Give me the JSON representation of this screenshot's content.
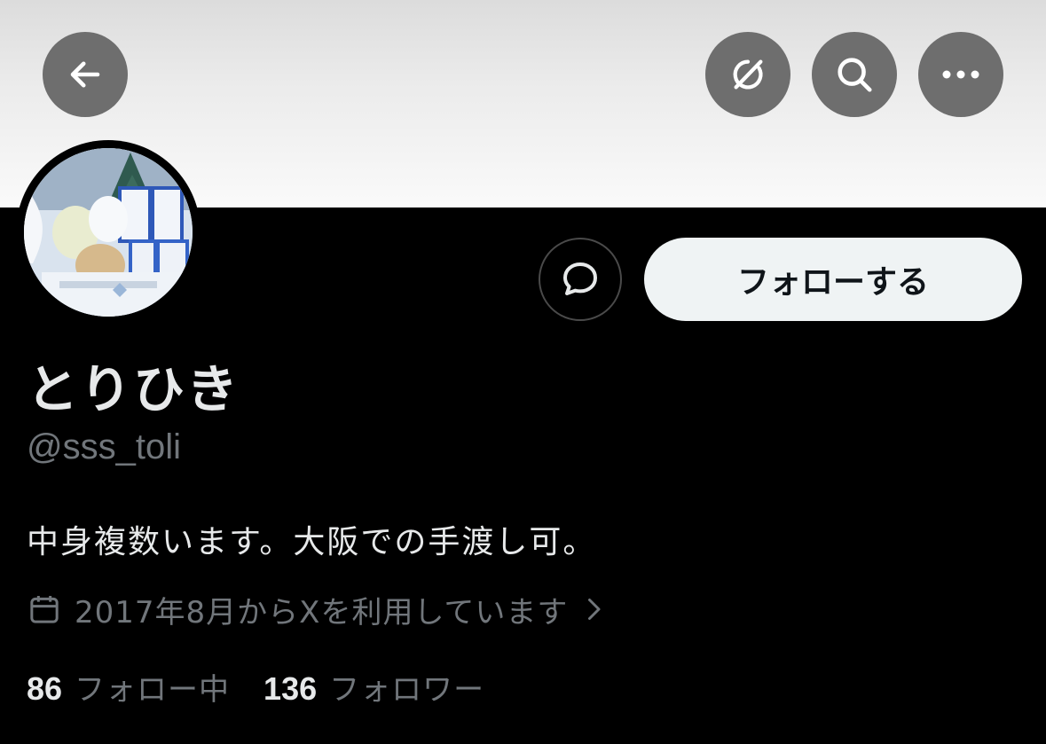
{
  "header": {
    "back_icon": "arrow-left-icon",
    "grok_icon": "grok-icon",
    "search_icon": "search-icon",
    "more_icon": "more-horizontal-icon"
  },
  "profile": {
    "display_name": "とりひき",
    "handle": "@sss_toli",
    "bio": "中身複数います。大阪での手渡し可。",
    "joined": "2017年8月からXを利用しています",
    "following_count": "86",
    "following_label": "フォロー中",
    "followers_count": "136",
    "followers_label": "フォロワー"
  },
  "actions": {
    "message_icon": "message-bubble-icon",
    "follow_label": "フォローする"
  },
  "colors": {
    "background": "#000000",
    "primary_text": "#e7e9ea",
    "secondary_text": "#71767b",
    "follow_button_bg": "#eff3f4",
    "header_button_bg": "#6e6e6e"
  }
}
